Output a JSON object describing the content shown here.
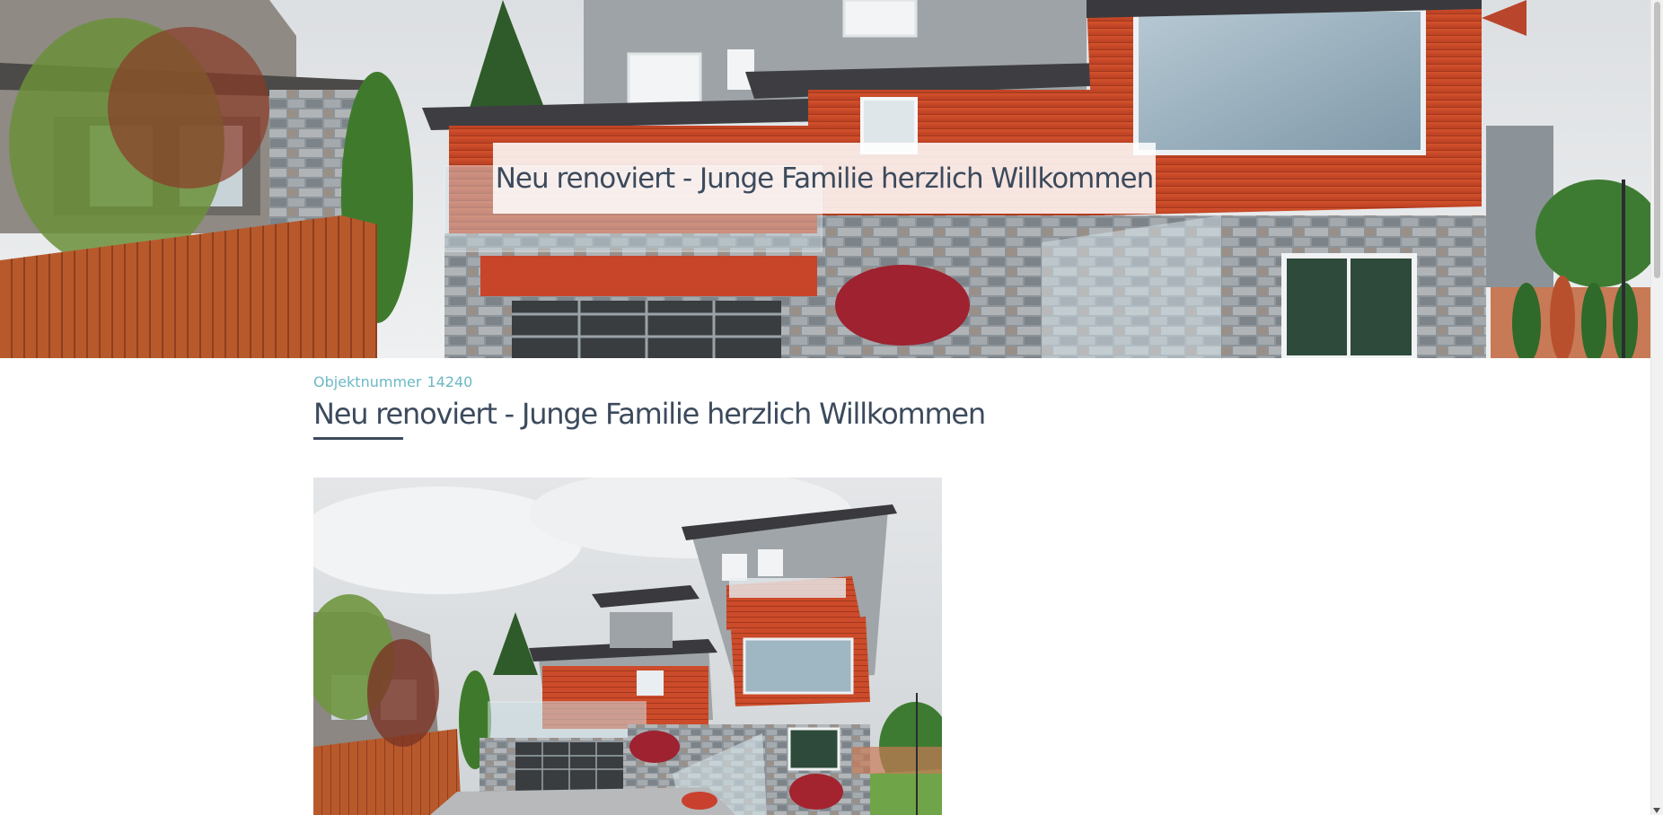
{
  "hero": {
    "title": "Neu renoviert - Junge Familie herzlich Willkommen"
  },
  "listing": {
    "object_number_label": "Objektnummer",
    "object_number_value": "14240",
    "title": "Neu renoviert - Junge Familie herzlich Willkommen"
  },
  "colors": {
    "accent_teal": "#6cb9c4",
    "heading_slate": "#3c4a5c",
    "cedar_red": "#c94a2a"
  },
  "icons": {
    "scroll_down": "triangle-down"
  }
}
